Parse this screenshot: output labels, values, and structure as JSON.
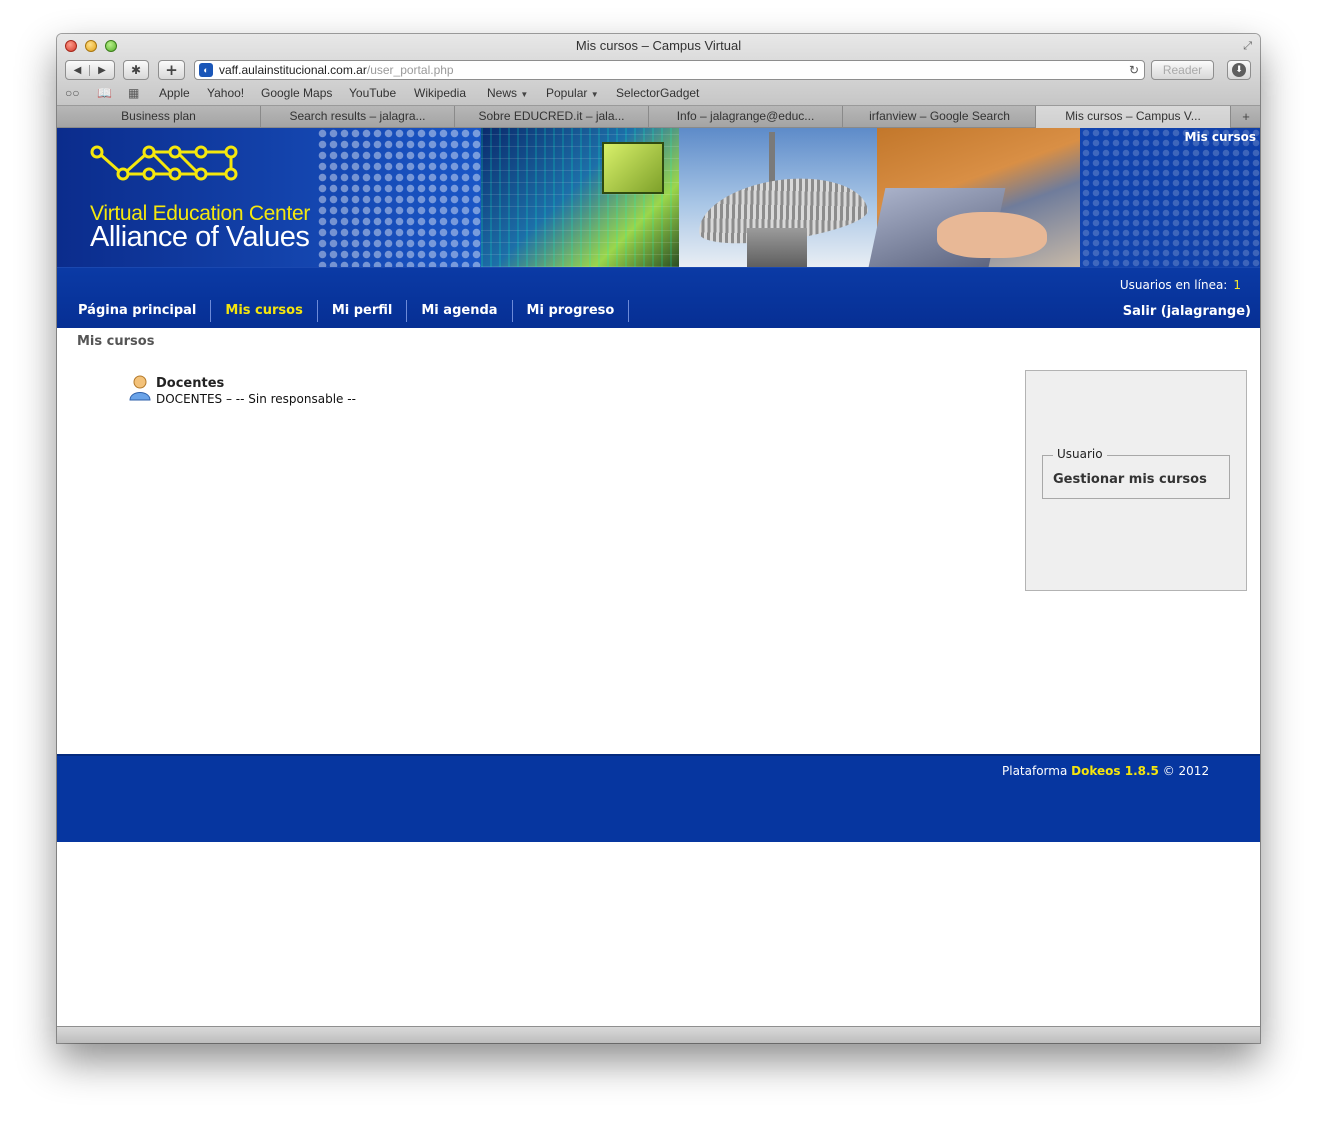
{
  "browser": {
    "window_title": "Mis cursos – Campus Virtual",
    "url_host": "vaff.aulainstitucional.com.ar",
    "url_path": "/user_portal.php",
    "reader_label": "Reader",
    "bookmarks": [
      "Apple",
      "Yahoo!",
      "Google Maps",
      "YouTube",
      "Wikipedia",
      "News",
      "Popular",
      "SelectorGadget"
    ],
    "tabs": [
      "Business plan",
      "Search results – jalagra...",
      "Sobre EDUCRED.it – jala...",
      "Info – jalagrange@educ...",
      "irfanview – Google Search",
      "Mis cursos – Campus V..."
    ],
    "icons": {
      "back": "back-arrow-icon",
      "forward": "forward-arrow-icon",
      "extensions": "puzzle-icon",
      "add": "plus-icon",
      "reload": "reload-icon",
      "download": "download-icon",
      "reading_list": "glasses-icon",
      "bookmarks": "open-book-icon",
      "top_sites": "grid-icon"
    }
  },
  "site": {
    "brand_line1": "Virtual Education Center",
    "brand_line2": "Alliance of Values",
    "banner_section": "Mis cursos",
    "online_label": "Usuarios en línea:",
    "online_count": "1",
    "nav": {
      "home": "Página principal",
      "courses": "Mis cursos",
      "profile": "Mi perfil",
      "agenda": "Mi agenda",
      "progress": "Mi progreso"
    },
    "logout": "Salir (jalagrange)",
    "breadcrumb": "Mis cursos"
  },
  "course": {
    "name": "Docentes",
    "description": "DOCENTES – -- Sin responsable --"
  },
  "sidebar": {
    "legend": "Usuario",
    "manage_courses": "Gestionar mis cursos"
  },
  "footer": {
    "prefix": "Plataforma",
    "brand": "Dokeos 1.8.5",
    "suffix": "© 2012"
  },
  "colors": {
    "accent_yellow": "#f5e50d",
    "nav_blue": "#0636a0",
    "banner_blue": "#1a56c6"
  }
}
